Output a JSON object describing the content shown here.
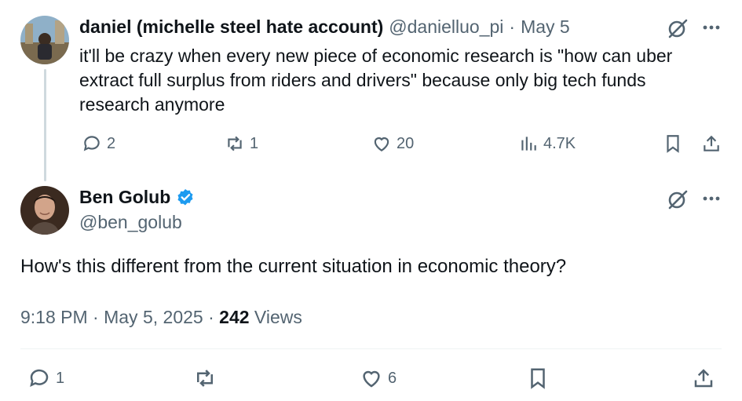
{
  "parent_tweet": {
    "author_name": "daniel (michelle steel hate account)",
    "handle": "@danielluo_pi",
    "separator": "·",
    "date": "May 5",
    "text": "it'll be crazy when every new piece of economic research is \"how can uber extract full surplus from riders and drivers\" because only big tech funds research anymore",
    "replies": "2",
    "reposts": "1",
    "likes": "20",
    "views": "4.7K"
  },
  "main_tweet": {
    "author_name": "Ben Golub",
    "handle": "@ben_golub",
    "text": "How's this different from the current situation in economic theory?",
    "time": "9:18 PM",
    "sep1": "·",
    "date": "May 5, 2025",
    "sep2": "·",
    "view_count": "242",
    "views_label": "Views",
    "replies": "1",
    "likes": "6"
  },
  "colors": {
    "text_primary": "#0f1419",
    "text_secondary": "#536471",
    "verified_blue": "#1d9bf0",
    "thread_line": "#cfd9de"
  },
  "icons": [
    "reply-icon",
    "repost-icon",
    "like-icon",
    "views-icon",
    "bookmark-icon",
    "share-icon",
    "grok-icon",
    "more-icon",
    "verified-badge-icon"
  ]
}
